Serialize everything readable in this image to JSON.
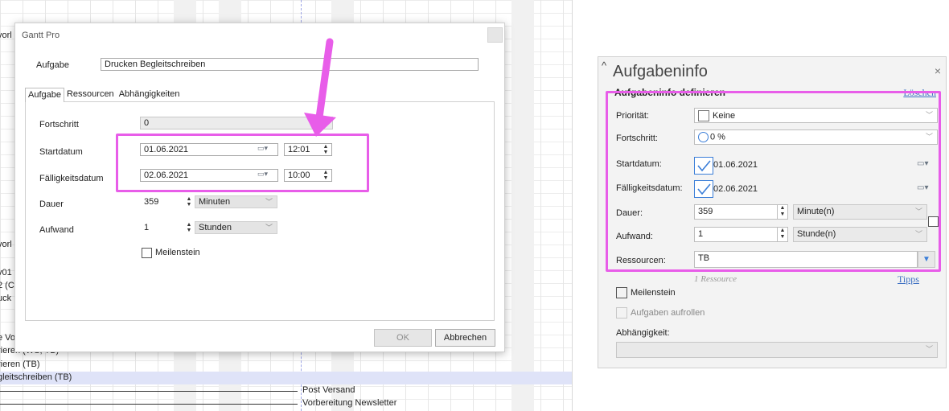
{
  "colors": {
    "highlight": "#e85de9",
    "accent": "#3b7ed8",
    "link": "#3c6fc2"
  },
  "gantt": {
    "fragments": [
      "vorl",
      "vorl",
      "v01",
      "2 (C",
      "uck",
      "e Vo",
      "rieren (WS, TB)",
      "rieren (TB)",
      "gleitschreiben (TB)"
    ],
    "task_labels": [
      "Post Versand",
      "Vorbereitung Newsletter"
    ]
  },
  "dialog": {
    "title": "Gantt Pro",
    "task_label": "Aufgabe",
    "task_value": "Drucken Begleitschreiben",
    "tabs": [
      "Aufgabe",
      "Ressourcen",
      "Abhängigkeiten"
    ],
    "progress_label": "Fortschritt",
    "progress_value": "0",
    "start_label": "Startdatum",
    "start_date": "01.06.2021",
    "start_time": "12:01",
    "due_label": "Fälligkeitsdatum",
    "due_date": "02.06.2021",
    "due_time": "10:00",
    "duration_label": "Dauer",
    "duration_value": "359",
    "duration_unit": "Minuten",
    "effort_label": "Aufwand",
    "effort_value": "1",
    "effort_unit": "Stunden",
    "milestone_label": "Meilenstein",
    "ok_label": "OK",
    "cancel_label": "Abbrechen"
  },
  "pane": {
    "title": "Aufgabeninfo",
    "close_glyph": "×",
    "caret_glyph": "^",
    "subtitle": "Aufgabeninfo definieren",
    "delete_link": "Löschen",
    "priority_label": "Priorität:",
    "priority_value": "Keine",
    "progress_label": "Fortschritt:",
    "progress_value": "0 %",
    "start_label": "Startdatum:",
    "start_value": "01.06.2021",
    "due_label": "Fälligkeitsdatum:",
    "due_value": "02.06.2021",
    "duration_label": "Dauer:",
    "duration_value": "359",
    "duration_unit": "Minute(n)",
    "effort_label": "Aufwand:",
    "effort_value": "1",
    "effort_unit": "Stunde(n)",
    "resources_label": "Ressourcen:",
    "resources_value": "TB",
    "resource_count": "1 Ressource",
    "tips_link": "Tipps",
    "milestone_label": "Meilenstein",
    "rollup_label": "Aufgaben aufrollen",
    "dependency_label": "Abhängigkeit:"
  }
}
